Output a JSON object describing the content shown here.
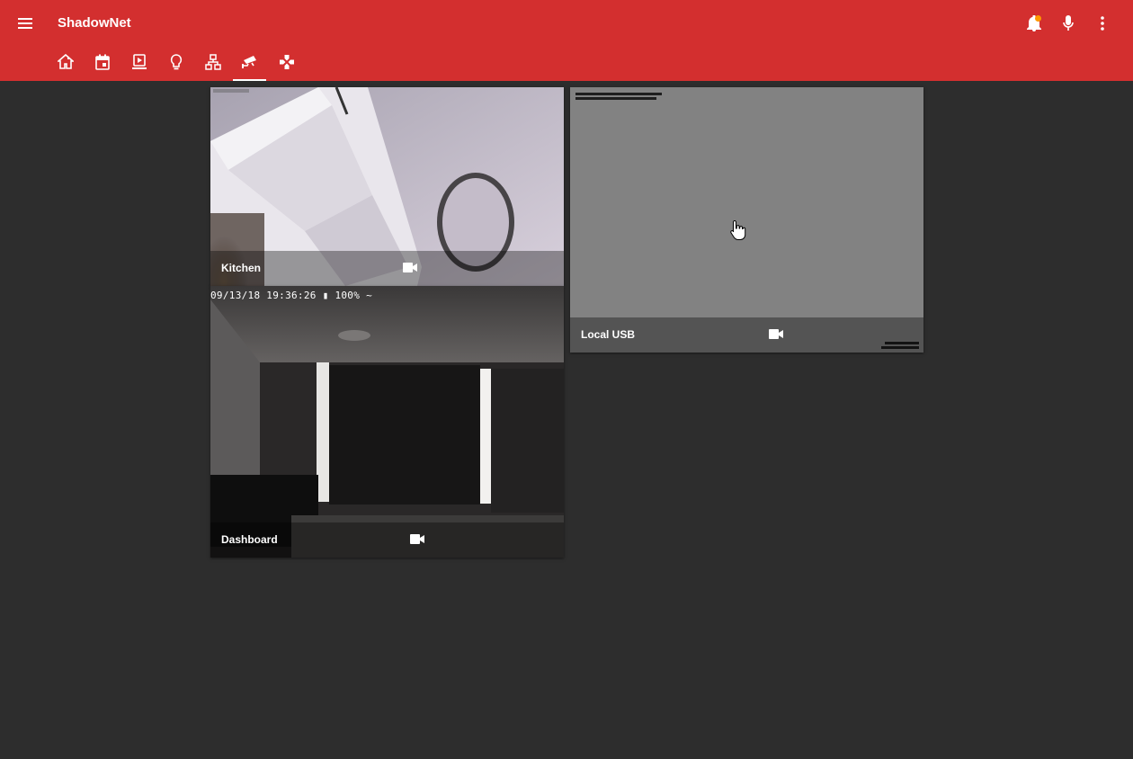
{
  "app": {
    "title": "ShadowNet"
  },
  "toolbar": {
    "icons": [
      "menu-icon",
      "notifications-icon",
      "microphone-icon",
      "more-vert-icon"
    ]
  },
  "tabs": [
    {
      "icon": "home-icon"
    },
    {
      "icon": "calendar-icon"
    },
    {
      "icon": "media-icon"
    },
    {
      "icon": "lightbulb-icon"
    },
    {
      "icon": "network-icon"
    },
    {
      "icon": "cctv-icon",
      "active": true
    },
    {
      "icon": "gamepad-icon"
    }
  ],
  "cameras": [
    {
      "name": "Kitchen",
      "icon": "videocam-icon"
    },
    {
      "name": "Dashboard",
      "icon": "videocam-icon",
      "overlay": "09/13/18 19:36:26 ▮ 100% ~"
    },
    {
      "name": "Local USB",
      "icon": "videocam-icon"
    }
  ],
  "colors": {
    "header": "#d32f2f",
    "background": "#2d2d2d",
    "notification_badge": "#ff9800"
  }
}
